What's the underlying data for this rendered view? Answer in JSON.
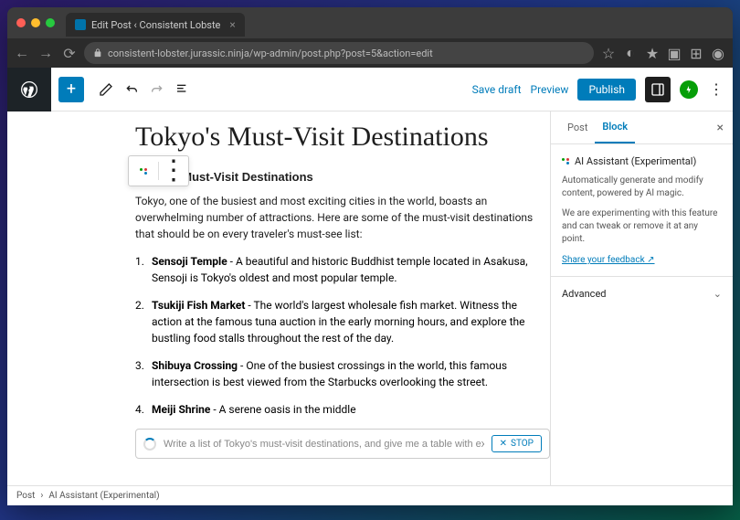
{
  "browser": {
    "tab_title": "Edit Post ‹ Consistent Lobste",
    "url": "consistent-lobster.jurassic.ninja/wp-admin/post.php?post=5&action=edit"
  },
  "toolbar": {
    "save_draft": "Save draft",
    "preview": "Preview",
    "publish": "Publish"
  },
  "post": {
    "title": "Tokyo's Must-Visit Destinations",
    "heading": "Tokyo's Must-Visit Destinations",
    "intro": "Tokyo, one of the busiest and most exciting cities in the world, boasts an overwhelming number of attractions. Here are some of the must-visit destinations that should be on every traveler's must-see list:",
    "items": [
      {
        "name": "Sensoji Temple",
        "desc": " - A beautiful and historic Buddhist temple located in Asakusa, Sensoji is Tokyo's oldest and most popular temple."
      },
      {
        "name": "Tsukiji Fish Market",
        "desc": " - The world's largest wholesale fish market. Witness the action at the famous tuna auction in the early morning hours, and explore the bustling food stalls throughout the rest of the day."
      },
      {
        "name": "Shibuya Crossing",
        "desc": " - One of the busiest crossings in the world, this famous intersection is best viewed from the Starbucks overlooking the street."
      },
      {
        "name": "Meiji Shrine",
        "desc": " - A serene oasis in the middle"
      }
    ]
  },
  "ai": {
    "prompt": "Write a list of Tokyo's must-visit destinations, and give me a table with exchange ra",
    "stop": "STOP"
  },
  "sidebar": {
    "tabs": {
      "post": "Post",
      "block": "Block"
    },
    "panel_title": "AI Assistant (Experimental)",
    "panel_desc1": "Automatically generate and modify content, powered by AI magic.",
    "panel_desc2": "We are experimenting with this feature and can tweak or remove it at any point.",
    "feedback": "Share your feedback ↗",
    "advanced": "Advanced"
  },
  "breadcrumb": {
    "root": "Post",
    "current": "AI Assistant (Experimental)"
  }
}
